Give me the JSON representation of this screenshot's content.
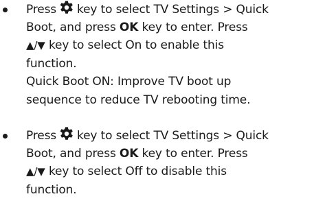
{
  "items": [
    {
      "line1_pre": "Press",
      "line1_post": "key to select TV Settings > Quick",
      "line2_pre": "Boot, and press ",
      "line2_bold": "OK",
      "line2_post": " key to enter. Press",
      "line3_arrows": "▲/▼",
      "line3_post": " key to select On to enable this",
      "line4": "function.",
      "line5": "Quick Boot ON: Improve TV boot up",
      "line6": "sequence to reduce TV rebooting time."
    },
    {
      "line1_pre": "Press",
      "line1_post": "key to select TV Settings > Quick",
      "line2_pre": "Boot, and press ",
      "line2_bold": "OK",
      "line2_post": " key to enter. Press",
      "line3_arrows": "▲/▼",
      "line3_post": " key to select Off to disable this",
      "line4": "function."
    }
  ],
  "icons": {
    "settings": "gear-icon"
  }
}
